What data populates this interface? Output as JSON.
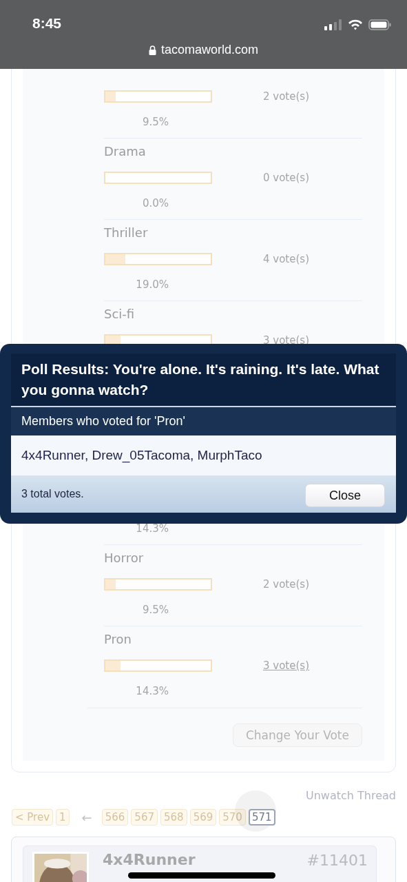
{
  "status_bar": {
    "time": "8:45",
    "url": "tacomaworld.com"
  },
  "poll_options": [
    {
      "kind": "option",
      "level": 0.095,
      "votes": "2 vote(s)",
      "votes_link": false,
      "percent": "9.5%"
    },
    {
      "kind": "option",
      "label": "Drama",
      "votes": "0 vote(s)",
      "votes_link": false,
      "percent": "0.0%"
    },
    {
      "kind": "option",
      "label": "Thriller",
      "level": 0.19,
      "votes": "4 vote(s)",
      "votes_link": false,
      "percent": "19.0%"
    },
    {
      "kind": "option",
      "label": "Sci-fi",
      "level": 0.143,
      "votes": "3 vote(s)"
    },
    {
      "kind": "covered"
    },
    {
      "kind": "option",
      "percent": "14.3%"
    },
    {
      "kind": "option",
      "label": "Horror",
      "level": 0.095,
      "votes": "2 vote(s)",
      "votes_link": false,
      "percent": "9.5%"
    },
    {
      "kind": "option",
      "label": "Pron",
      "level": 0.143,
      "votes": "3 vote(s)",
      "votes_link": true,
      "percent": "14.3%"
    }
  ],
  "change_vote_button": "Change Your Vote",
  "unwatch_link": "Unwatch Thread",
  "pagination": [
    {
      "label": "< Prev",
      "kind": "page",
      "selected": false
    },
    {
      "label": "1",
      "kind": "page",
      "selected": false
    },
    {
      "label": "←",
      "kind": "gap"
    },
    {
      "label": "566",
      "kind": "page",
      "selected": false
    },
    {
      "label": "567",
      "kind": "page",
      "selected": false
    },
    {
      "label": "568",
      "kind": "page",
      "selected": false
    },
    {
      "label": "569",
      "kind": "page",
      "selected": false
    },
    {
      "label": "570",
      "kind": "page",
      "selected": false
    },
    {
      "label": "571",
      "kind": "page",
      "selected": true
    }
  ],
  "post": {
    "author": "4x4Runner",
    "number": "#11401"
  },
  "dialog": {
    "title": "Poll Results: You're alone. It's raining. It's late. What you gonna watch?",
    "subtitle": "Members who voted for 'Pron'",
    "voters": "4x4Runner, Drew_05Tacoma, MurphTaco",
    "total": "3 total votes.",
    "close_button": "Close"
  }
}
